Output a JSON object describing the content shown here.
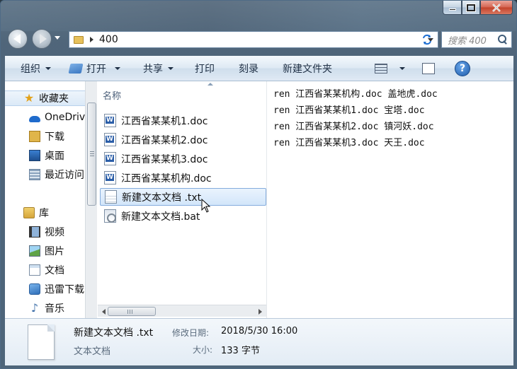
{
  "address": {
    "segments": [
      "400"
    ]
  },
  "search": {
    "placeholder": "搜索 400"
  },
  "toolbar": {
    "organize": "组织",
    "open": "打开",
    "share": "共享",
    "print": "打印",
    "burn": "刻录",
    "new_folder": "新建文件夹"
  },
  "nav_pane": {
    "items": [
      {
        "label": "收藏夹",
        "icon": "star-icon"
      },
      {
        "label": "OneDrive",
        "icon": "cloud-icon"
      },
      {
        "label": "下载",
        "icon": "downloads-icon"
      },
      {
        "label": "桌面",
        "icon": "desktop-icon"
      },
      {
        "label": "最近访问的位置",
        "icon": "recent-places-icon"
      },
      {
        "label": "库",
        "icon": "library-icon"
      },
      {
        "label": "视频",
        "icon": "video-icon"
      },
      {
        "label": "图片",
        "icon": "pictures-icon"
      },
      {
        "label": "文档",
        "icon": "documents-icon"
      },
      {
        "label": "迅雷下载",
        "icon": "thunder-icon"
      },
      {
        "label": "音乐",
        "icon": "music-icon"
      }
    ]
  },
  "file_list": {
    "column_name": "名称",
    "files": [
      {
        "name": "江西省某某机1.doc",
        "type": "doc"
      },
      {
        "name": "江西省某某机2.doc",
        "type": "doc"
      },
      {
        "name": "江西省某某机3.doc",
        "type": "doc"
      },
      {
        "name": "江西省某某机构.doc",
        "type": "doc"
      },
      {
        "name": "新建文本文档 .txt",
        "type": "txt",
        "selected": true
      },
      {
        "name": "新建文本文档.bat",
        "type": "bat"
      }
    ]
  },
  "preview": {
    "lines": [
      "ren 江西省某某机构.doc 盖地虎.doc",
      "ren 江西省某某机1.doc 宝塔.doc",
      "ren 江西省某某机2.doc 镇河妖.doc",
      "ren 江西省某某机3.doc 天王.doc"
    ]
  },
  "details": {
    "file_name": "新建文本文档 .txt",
    "modified_label": "修改日期:",
    "modified_value": "2018/5/30 16:00",
    "type": "文本文档",
    "size_label": "大小:",
    "size_value": "133 字节"
  },
  "colors": {
    "selection": "#d3e6fa",
    "selection_border": "#84acdd",
    "command_text": "#1e2f44",
    "close_button": "#c2412a"
  }
}
